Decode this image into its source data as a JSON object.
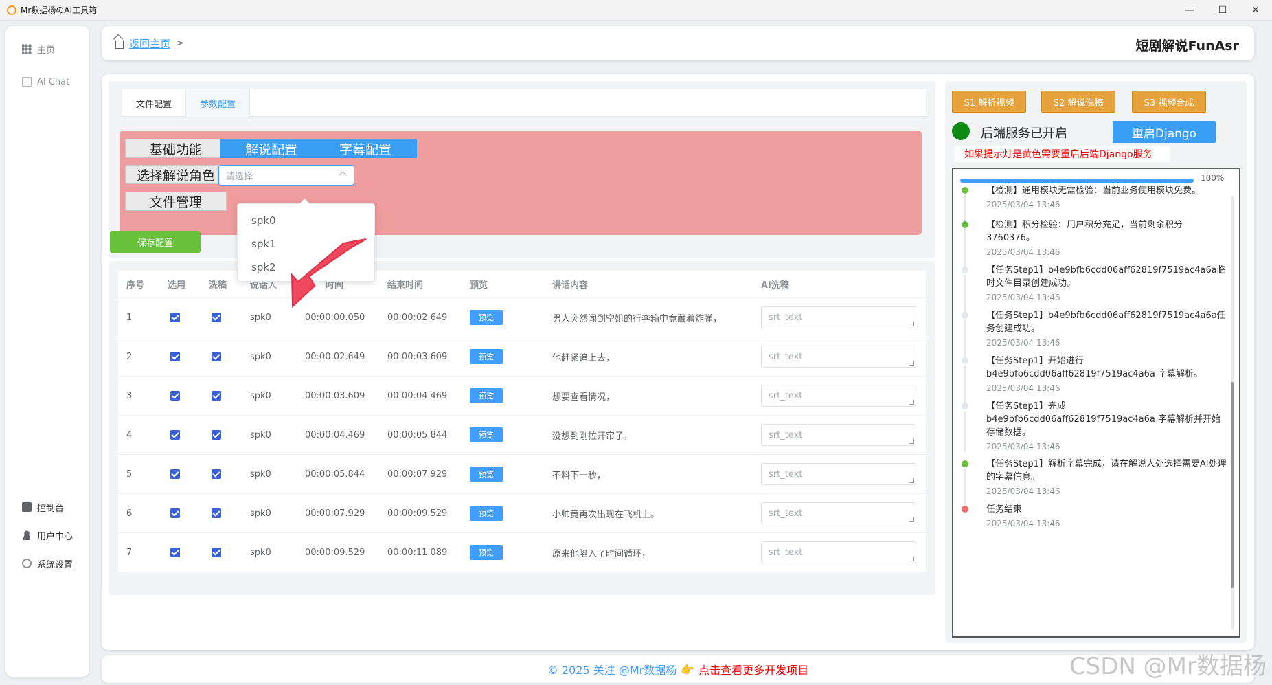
{
  "window": {
    "title": "Mr数据杨のAI工具箱",
    "min": "—",
    "max": "☐",
    "close": "✕"
  },
  "sidebar": {
    "top": [
      {
        "label": "主页",
        "icon": "grid-icon"
      },
      {
        "label": "AI Chat",
        "icon": "chat-icon"
      }
    ],
    "bottom": [
      {
        "label": "控制台",
        "icon": "monitor-icon"
      },
      {
        "label": "用户中心",
        "icon": "user-icon"
      },
      {
        "label": "系统设置",
        "icon": "gear-icon"
      }
    ]
  },
  "header": {
    "back": "返回主页",
    "sep": ">",
    "title": "短剧解说FunAsr"
  },
  "config": {
    "tabs": [
      "文件配置",
      "参数配置"
    ],
    "active_tab": 1,
    "btn_basic": "基础功能",
    "btn_narr": "解说配置",
    "btn_sub": "字幕配置",
    "btn_role": "选择解说角色",
    "btn_files": "文件管理",
    "select_placeholder": "请选择",
    "options": [
      "spk0",
      "spk1",
      "spk2"
    ],
    "save": "保存配置"
  },
  "table": {
    "headers": [
      "序号",
      "选用",
      "洗稿",
      "说话人",
      "",
      "结束时间",
      "预览",
      "讲话内容",
      "AI洗稿"
    ],
    "header_partial": "时间",
    "preview_label": "预览",
    "textarea_placeholder": "srt_text",
    "rows": [
      {
        "no": "1",
        "spk": "spk0",
        "start": "00:00:00.050",
        "end": "00:00:02.649",
        "text": "男人突然闻到空姐的行李箱中竟藏着炸弹，"
      },
      {
        "no": "2",
        "spk": "spk0",
        "start": "00:00:02.649",
        "end": "00:00:03.609",
        "text": "他赶紧追上去，"
      },
      {
        "no": "3",
        "spk": "spk0",
        "start": "00:00:03.609",
        "end": "00:00:04.469",
        "text": "想要查看情况，"
      },
      {
        "no": "4",
        "spk": "spk0",
        "start": "00:00:04.469",
        "end": "00:00:05.844",
        "text": "没想到刚拉开帘子，"
      },
      {
        "no": "5",
        "spk": "spk0",
        "start": "00:00:05.844",
        "end": "00:00:07.929",
        "text": "不料下一秒，"
      },
      {
        "no": "6",
        "spk": "spk0",
        "start": "00:00:07.929",
        "end": "00:00:09.529",
        "text": "小帅竟再次出现在飞机上。"
      },
      {
        "no": "7",
        "spk": "spk0",
        "start": "00:00:09.529",
        "end": "00:00:11.089",
        "text": "原来他陷入了时间循环，"
      }
    ]
  },
  "right": {
    "s1": "S1 解析视频",
    "s2": "S2 解说洗稿",
    "s3": "S3 视频合成",
    "status": "后端服务已开启",
    "status_color": "#0c8a12",
    "restart": "重启Django",
    "warn": "如果提示灯是黄色需要重启后端Django服务",
    "progress_pct": 100,
    "progress_label": "100%",
    "logs": [
      {
        "text": "【检测】通用模块无需检验：当前业务使用模块免费。",
        "time": "2025/03/04 13:46",
        "color": "#67c23a"
      },
      {
        "text": "【检测】积分检验：用户积分充足，当前剩余积分3760376。",
        "time": "2025/03/04 13:46",
        "color": "#67c23a"
      },
      {
        "text": "【任务Step1】b4e9bfb6cdd06aff62819f7519ac4a6a临时文件目录创建成功。",
        "time": "2025/03/04 13:46",
        "color": "#e4e7ed"
      },
      {
        "text": "【任务Step1】b4e9bfb6cdd06aff62819f7519ac4a6a任务创建成功。",
        "time": "2025/03/04 13:46",
        "color": "#e4e7ed"
      },
      {
        "text": "【任务Step1】开始进行b4e9bfb6cdd06aff62819f7519ac4a6a 字幕解析。",
        "time": "2025/03/04 13:46",
        "color": "#e4e7ed"
      },
      {
        "text": "【任务Step1】完成b4e9bfb6cdd06aff62819f7519ac4a6a 字幕解析并开始存储数据。",
        "time": "2025/03/04 13:46",
        "color": "#e4e7ed"
      },
      {
        "text": "【任务Step1】解析字幕完成，请在解说人处选择需要AI处理的字幕信息。",
        "time": "2025/03/04 13:46",
        "color": "#67c23a"
      },
      {
        "text": "任务结束",
        "time": "2025/03/04 13:46",
        "color": "#f56c6c"
      }
    ]
  },
  "footer": {
    "copy": "© 2025 关注 @Mr数据杨",
    "hand": "👉",
    "link": "点击查看更多开发项目"
  },
  "watermark": "CSDN @Mr数据杨"
}
